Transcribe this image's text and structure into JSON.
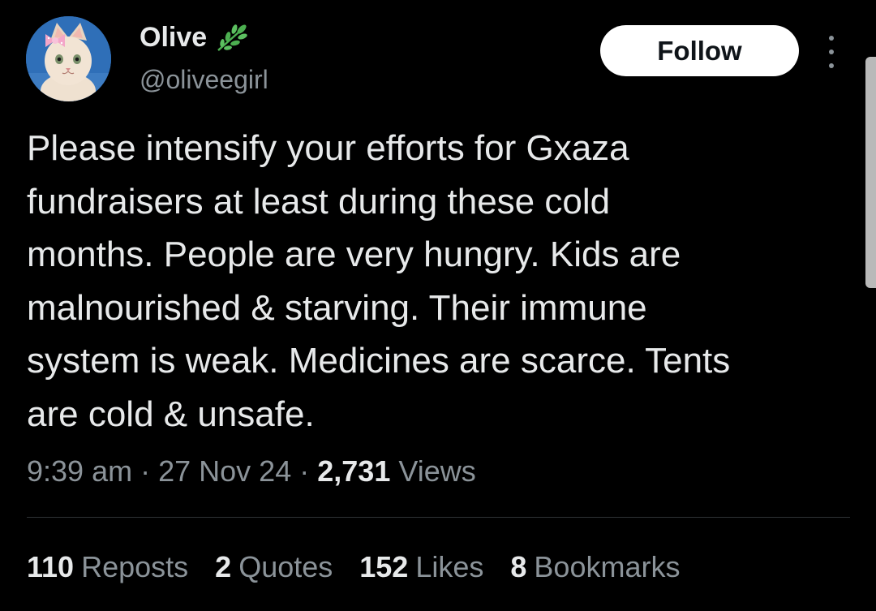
{
  "user": {
    "display_name": "Olive",
    "badge_icon": "leaf-icon",
    "handle": "@oliveegirl",
    "avatar": "cat-with-pink-bow-avatar"
  },
  "actions": {
    "follow_label": "Follow",
    "more_icon": "more-vertical-icon"
  },
  "tweet": {
    "text": "Please intensify your efforts for Gxaza\nfundraisers at least during these cold\nmonths. People are very hungry. Kids are\nmalnourished & starving. Their immune\nsystem is weak. Medicines are scarce. Tents\nare cold & unsafe.",
    "time": "9:39 am",
    "separator": "·",
    "date": "27 Nov 24",
    "views_count": "2,731",
    "views_label": "Views"
  },
  "stats": [
    {
      "count": "110",
      "label": "Reposts"
    },
    {
      "count": "2",
      "label": "Quotes"
    },
    {
      "count": "152",
      "label": "Likes"
    },
    {
      "count": "8",
      "label": "Bookmarks"
    }
  ],
  "colors": {
    "background": "#000000",
    "text_primary": "#e7e9ea",
    "text_secondary": "#8b9399",
    "follow_button_bg": "#ffffff",
    "leaf_green": "#4caf50",
    "avatar_bg": "#2f6fb8",
    "bow_pink": "#f4a6c8"
  }
}
